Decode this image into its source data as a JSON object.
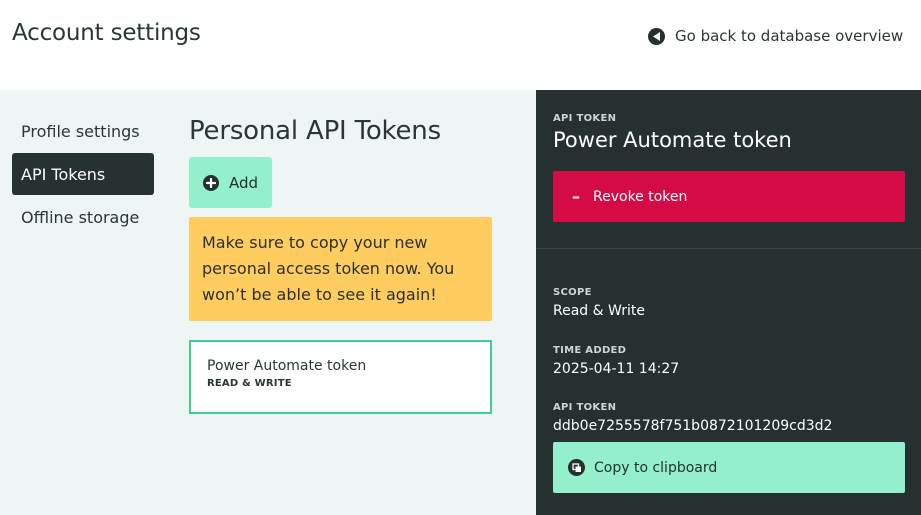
{
  "header": {
    "title": "Account settings",
    "back_label": "Go back to database overview"
  },
  "sidebar": {
    "items": [
      {
        "label": "Profile settings",
        "active": false
      },
      {
        "label": "API Tokens",
        "active": true
      },
      {
        "label": "Offline storage",
        "active": false
      }
    ]
  },
  "main": {
    "title": "Personal API Tokens",
    "add_label": "Add",
    "warning": "Make sure to copy your new personal access token now. You won’t be able to see it again!",
    "tokens": [
      {
        "name": "Power Automate token",
        "scope": "READ & WRITE"
      }
    ]
  },
  "panel": {
    "kicker": "API TOKEN",
    "title": "Power Automate token",
    "revoke_label": "Revoke token",
    "scope_label": "SCOPE",
    "scope_value": "Read & Write",
    "time_label": "TIME ADDED",
    "time_value": "2025-04-11 14:27",
    "token_label": "API TOKEN",
    "token_value": "ddb0e7255578f751b0872101209cd3d2",
    "copy_label": "Copy to clipboard"
  },
  "colors": {
    "dark": "#263030",
    "accent_green": "#93efcc",
    "warning_yellow": "#ffcd5f",
    "danger_red": "#d50b45",
    "content_bg": "#eef5f4"
  }
}
